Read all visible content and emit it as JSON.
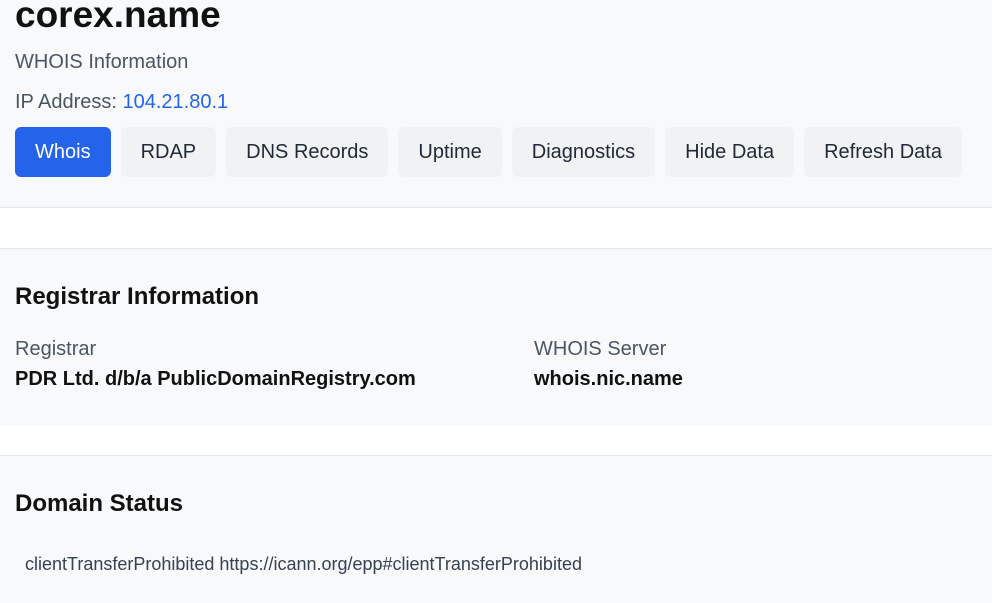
{
  "header": {
    "domain": "corex.name",
    "subtitle": "WHOIS Information",
    "ip_label": "IP Address:",
    "ip_value": "104.21.80.1"
  },
  "tabs": [
    {
      "label": "Whois",
      "active": true
    },
    {
      "label": "RDAP",
      "active": false
    },
    {
      "label": "DNS Records",
      "active": false
    },
    {
      "label": "Uptime",
      "active": false
    },
    {
      "label": "Diagnostics",
      "active": false
    },
    {
      "label": "Hide Data",
      "active": false
    },
    {
      "label": "Refresh Data",
      "active": false
    }
  ],
  "registrar": {
    "title": "Registrar Information",
    "registrar_label": "Registrar",
    "registrar_value": "PDR Ltd. d/b/a PublicDomainRegistry.com",
    "whois_server_label": "WHOIS Server",
    "whois_server_value": "whois.nic.name"
  },
  "domain_status": {
    "title": "Domain Status",
    "statuses": [
      "clientTransferProhibited https://icann.org/epp#clientTransferProhibited"
    ]
  },
  "colors": {
    "accent": "#2563eb",
    "section_bg": "#f8f9fb",
    "tab_bg": "#f1f2f4"
  }
}
